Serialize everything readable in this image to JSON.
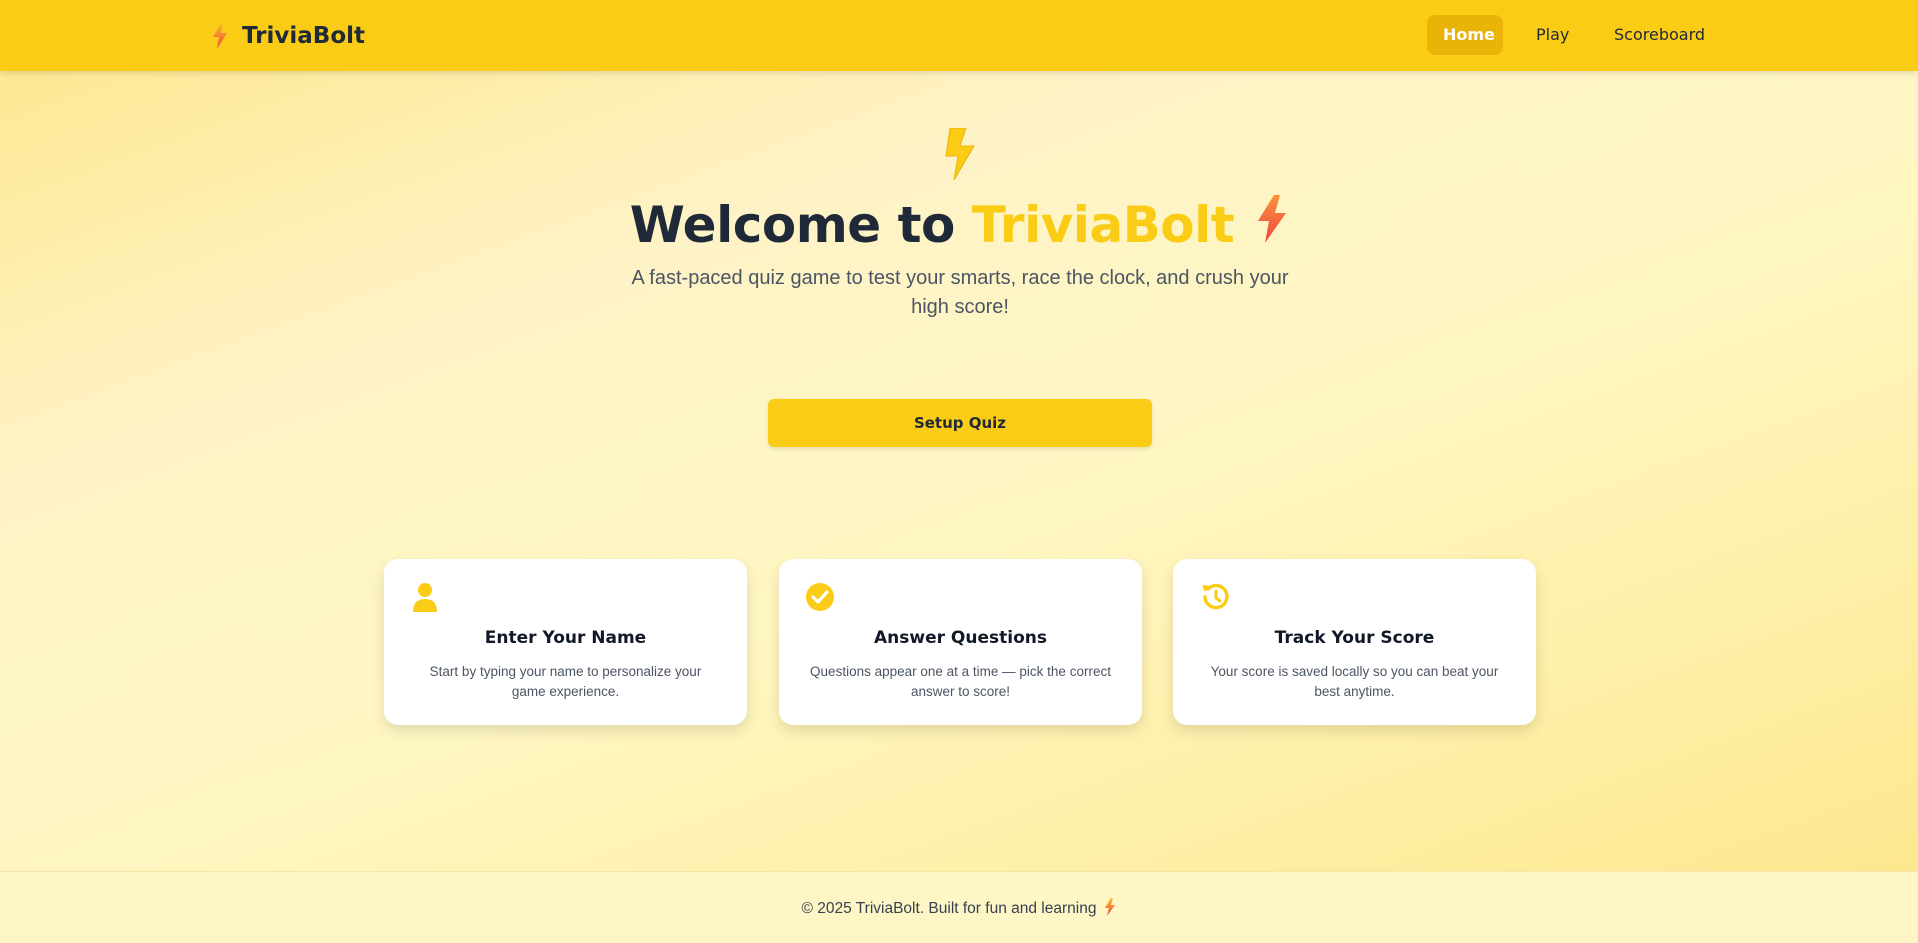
{
  "header": {
    "brand_name": "TriviaBolt",
    "brand_icon": "bolt-icon",
    "nav": [
      {
        "label": "Home",
        "active": true
      },
      {
        "label": "Play",
        "active": false
      },
      {
        "label": "Scoreboard",
        "active": false
      }
    ]
  },
  "hero": {
    "title_prefix": "Welcome to",
    "title_accent": "TriviaBolt",
    "subtitle": "A fast-paced quiz game to test your smarts, race the clock, and crush your high score!",
    "cta_label": "Setup Quiz"
  },
  "cards": [
    {
      "icon": "user-icon",
      "title": "Enter Your Name",
      "description": "Start by typing your name to personalize your game experience."
    },
    {
      "icon": "check-circle-icon",
      "title": "Answer Questions",
      "description": "Questions appear one at a time — pick the correct answer to score!"
    },
    {
      "icon": "history-icon",
      "title": "Track Your Score",
      "description": "Your score is saved locally so you can beat your best anytime."
    }
  ],
  "footer": {
    "text": "© 2025 TriviaBolt. Built for fun and learning"
  },
  "colors": {
    "primary": "#facc15",
    "nav_active": "#eab308",
    "bolt_orange": "#fb923c",
    "text_dark": "#1f2937"
  }
}
